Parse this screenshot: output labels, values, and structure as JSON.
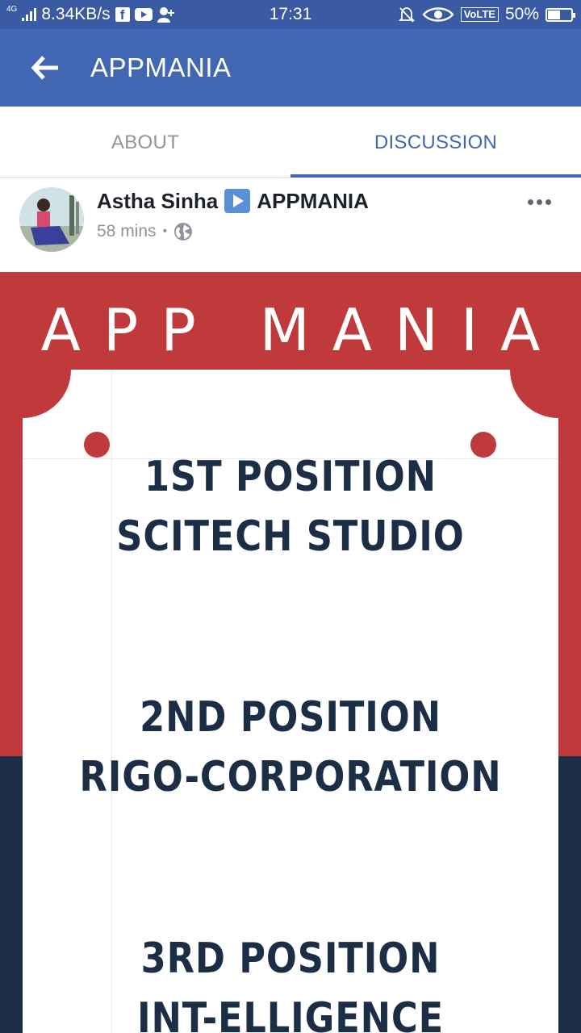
{
  "status_bar": {
    "network_label": "4G",
    "speed": "8.34KB/s",
    "time": "17:31",
    "volte": "VoLTE",
    "battery": "50%",
    "battery_level": 0.5,
    "icons": [
      "signal-icon",
      "facebook-icon",
      "youtube-icon",
      "add-user-icon",
      "mute-bell-icon",
      "eye-icon",
      "battery-icon"
    ]
  },
  "app_bar": {
    "title": "APPMANIA"
  },
  "tabs": [
    {
      "label": "ABOUT",
      "active": false
    },
    {
      "label": "DISCUSSION",
      "active": true
    }
  ],
  "post": {
    "author": "Astha Sinha",
    "group": "APPMANIA",
    "time": "58 mins",
    "privacy_icon": "globe-icon"
  },
  "poster": {
    "title": "APP MANIA",
    "entries": [
      {
        "position": "1ST POSITION",
        "name": "SCITECH STUDIO"
      },
      {
        "position": "2ND POSITION",
        "name": "RIGO-CORPORATION"
      },
      {
        "position": "3RD POSITION",
        "name": "INT-ELLIGENCE"
      }
    ],
    "colors": {
      "red": "#c0393b",
      "navy": "#1b2e45",
      "white": "#ffffff"
    }
  },
  "colors": {
    "status_bar": "#3a5aa3",
    "app_bar": "#4267b2",
    "tab_active": "#4267b2",
    "tab_inactive": "#90949c"
  }
}
